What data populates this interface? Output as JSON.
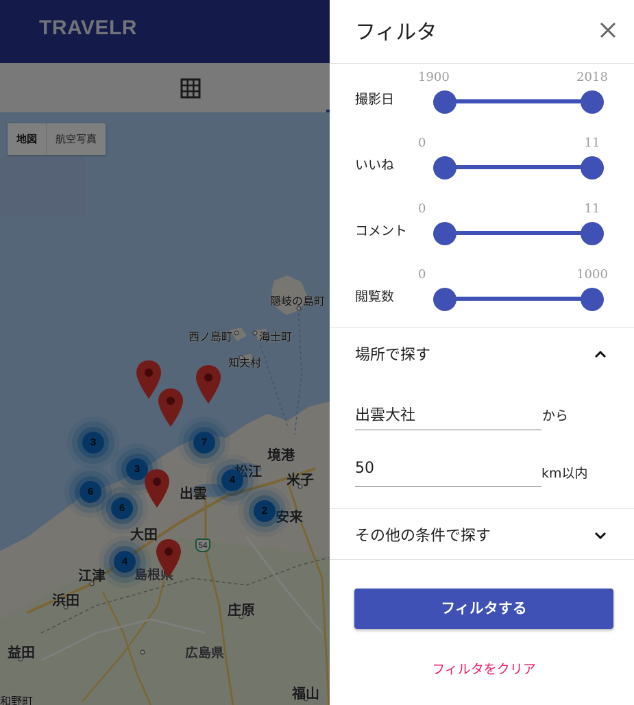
{
  "app": {
    "title": "TRAVELR"
  },
  "toolbar": {
    "view_icon": "grid-icon"
  },
  "map": {
    "type_control": {
      "map_label": "地図",
      "satellite_label": "航空写真"
    },
    "labels": {
      "oki": "隠岐の島町",
      "nishinoshima": "西ノ島町",
      "ama": "海士町",
      "chibu": "知夫村",
      "sakaiminato": "境港",
      "matsue": "松江",
      "yonago": "米子",
      "izumo": "出雲",
      "yasugi": "安来",
      "oda": "大田",
      "gotsu": "江津",
      "shimane": "島根県",
      "hamada": "浜田",
      "shobara": "庄原",
      "hiroshima": "広島県",
      "masuda": "益田",
      "fukuyama": "福山",
      "tsuwano": "和野町",
      "route": "54"
    },
    "clusters": [
      {
        "id": "c1",
        "count": "3"
      },
      {
        "id": "c2",
        "count": "7"
      },
      {
        "id": "c3",
        "count": "3"
      },
      {
        "id": "c4",
        "count": "4"
      },
      {
        "id": "c5",
        "count": "6"
      },
      {
        "id": "c6",
        "count": "6"
      },
      {
        "id": "c7",
        "count": "2"
      },
      {
        "id": "c8",
        "count": "4"
      }
    ]
  },
  "filter": {
    "title": "フィルタ",
    "close_icon": "close-icon",
    "sliders": [
      {
        "label": "撮影日",
        "min": "1900",
        "max": "2018",
        "low_fraction": 0,
        "high_fraction": 1
      },
      {
        "label": "いいね",
        "min": "0",
        "max": "11",
        "low_fraction": 0,
        "high_fraction": 1
      },
      {
        "label": "コメント",
        "min": "0",
        "max": "11",
        "low_fraction": 0,
        "high_fraction": 1
      },
      {
        "label": "閲覧数",
        "min": "0",
        "max": "1000",
        "low_fraction": 0,
        "high_fraction": 1
      }
    ],
    "location_section": {
      "title": "場所で探す",
      "expanded": true,
      "place_value": "出雲大社",
      "place_suffix": "から",
      "distance_value": "50",
      "distance_suffix": "km以内"
    },
    "other_section": {
      "title": "その他の条件で探す",
      "expanded": false
    },
    "apply_label": "フィルタする",
    "clear_label": "フィルタをクリア",
    "accent": "#3f51b5",
    "clear_color": "#e91e63"
  }
}
